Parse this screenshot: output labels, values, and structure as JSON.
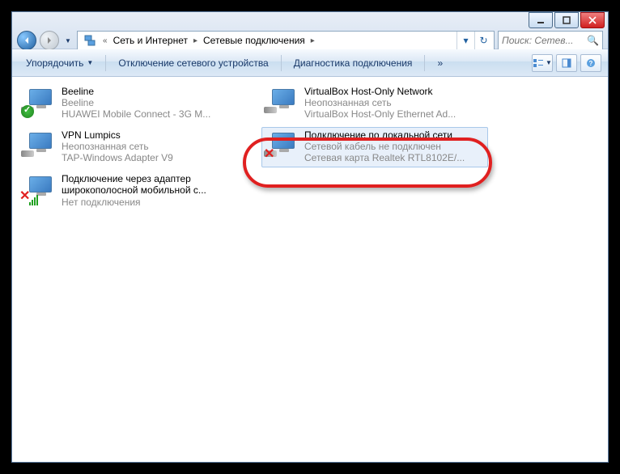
{
  "window": {
    "breadcrumbs": [
      "Сеть и Интернет",
      "Сетевые подключения"
    ],
    "search_placeholder": "Поиск: Сетев..."
  },
  "toolbar": {
    "organize": "Упорядочить",
    "disable": "Отключение сетевого устройства",
    "diagnose": "Диагностика подключения",
    "overflow": "»"
  },
  "connections": [
    {
      "name": "Beeline",
      "status": "Beeline",
      "device": "HUAWEI Mobile Connect - 3G M...",
      "badge": "check"
    },
    {
      "name": "VirtualBox Host-Only Network",
      "status": "Неопознанная сеть",
      "device": "VirtualBox Host-Only Ethernet Ad...",
      "badge": "none"
    },
    {
      "name": "VPN Lumpics",
      "status": "Неопознанная сеть",
      "device": "TAP-Windows Adapter V9",
      "badge": "none"
    },
    {
      "name": "Подключение по локальной сети",
      "status": "Сетевой кабель не подключен",
      "device": "Сетевая карта Realtek RTL8102E/...",
      "badge": "x",
      "selected": true,
      "highlighted": true
    },
    {
      "name": "Подключение через адаптер широкополосной мобильной с...",
      "status": "Нет подключения",
      "device": "",
      "badge": "xbars"
    }
  ]
}
